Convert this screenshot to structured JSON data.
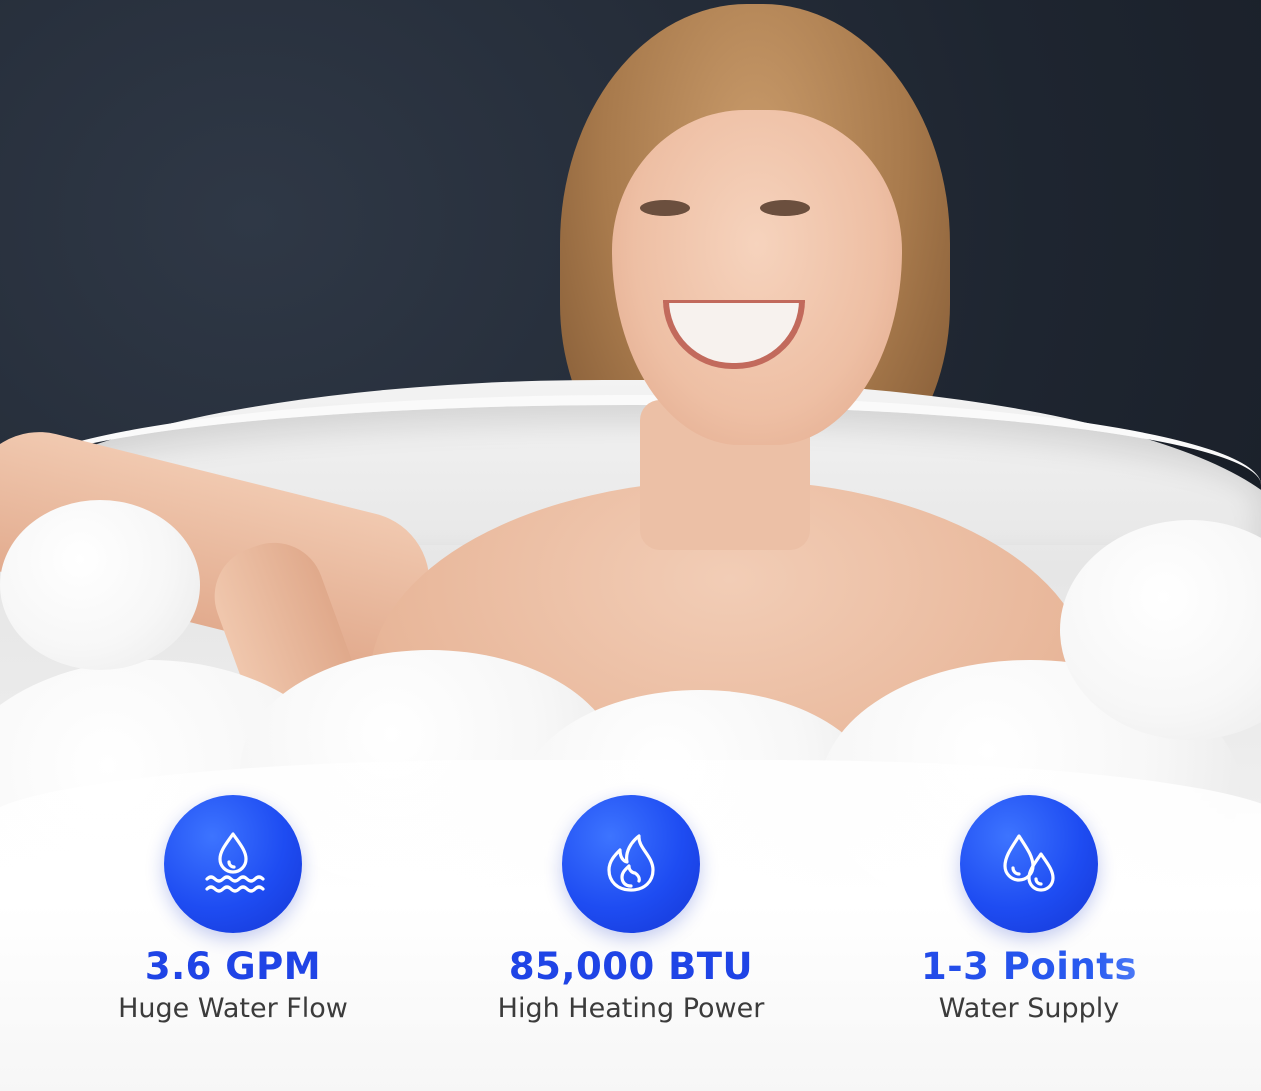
{
  "features": [
    {
      "icon": "water-flow-icon",
      "value": "3.6 GPM",
      "label": "Huge Water Flow"
    },
    {
      "icon": "flame-icon",
      "value": "85,000 BTU",
      "label": "High Heating Power"
    },
    {
      "icon": "water-drops-icon",
      "value": "1-3 Points",
      "label": "Water Supply"
    }
  ],
  "colors": {
    "accent_blue": "#1f44e6",
    "icon_circle": "#1e4cf2",
    "label_text": "#3b3b3b"
  }
}
